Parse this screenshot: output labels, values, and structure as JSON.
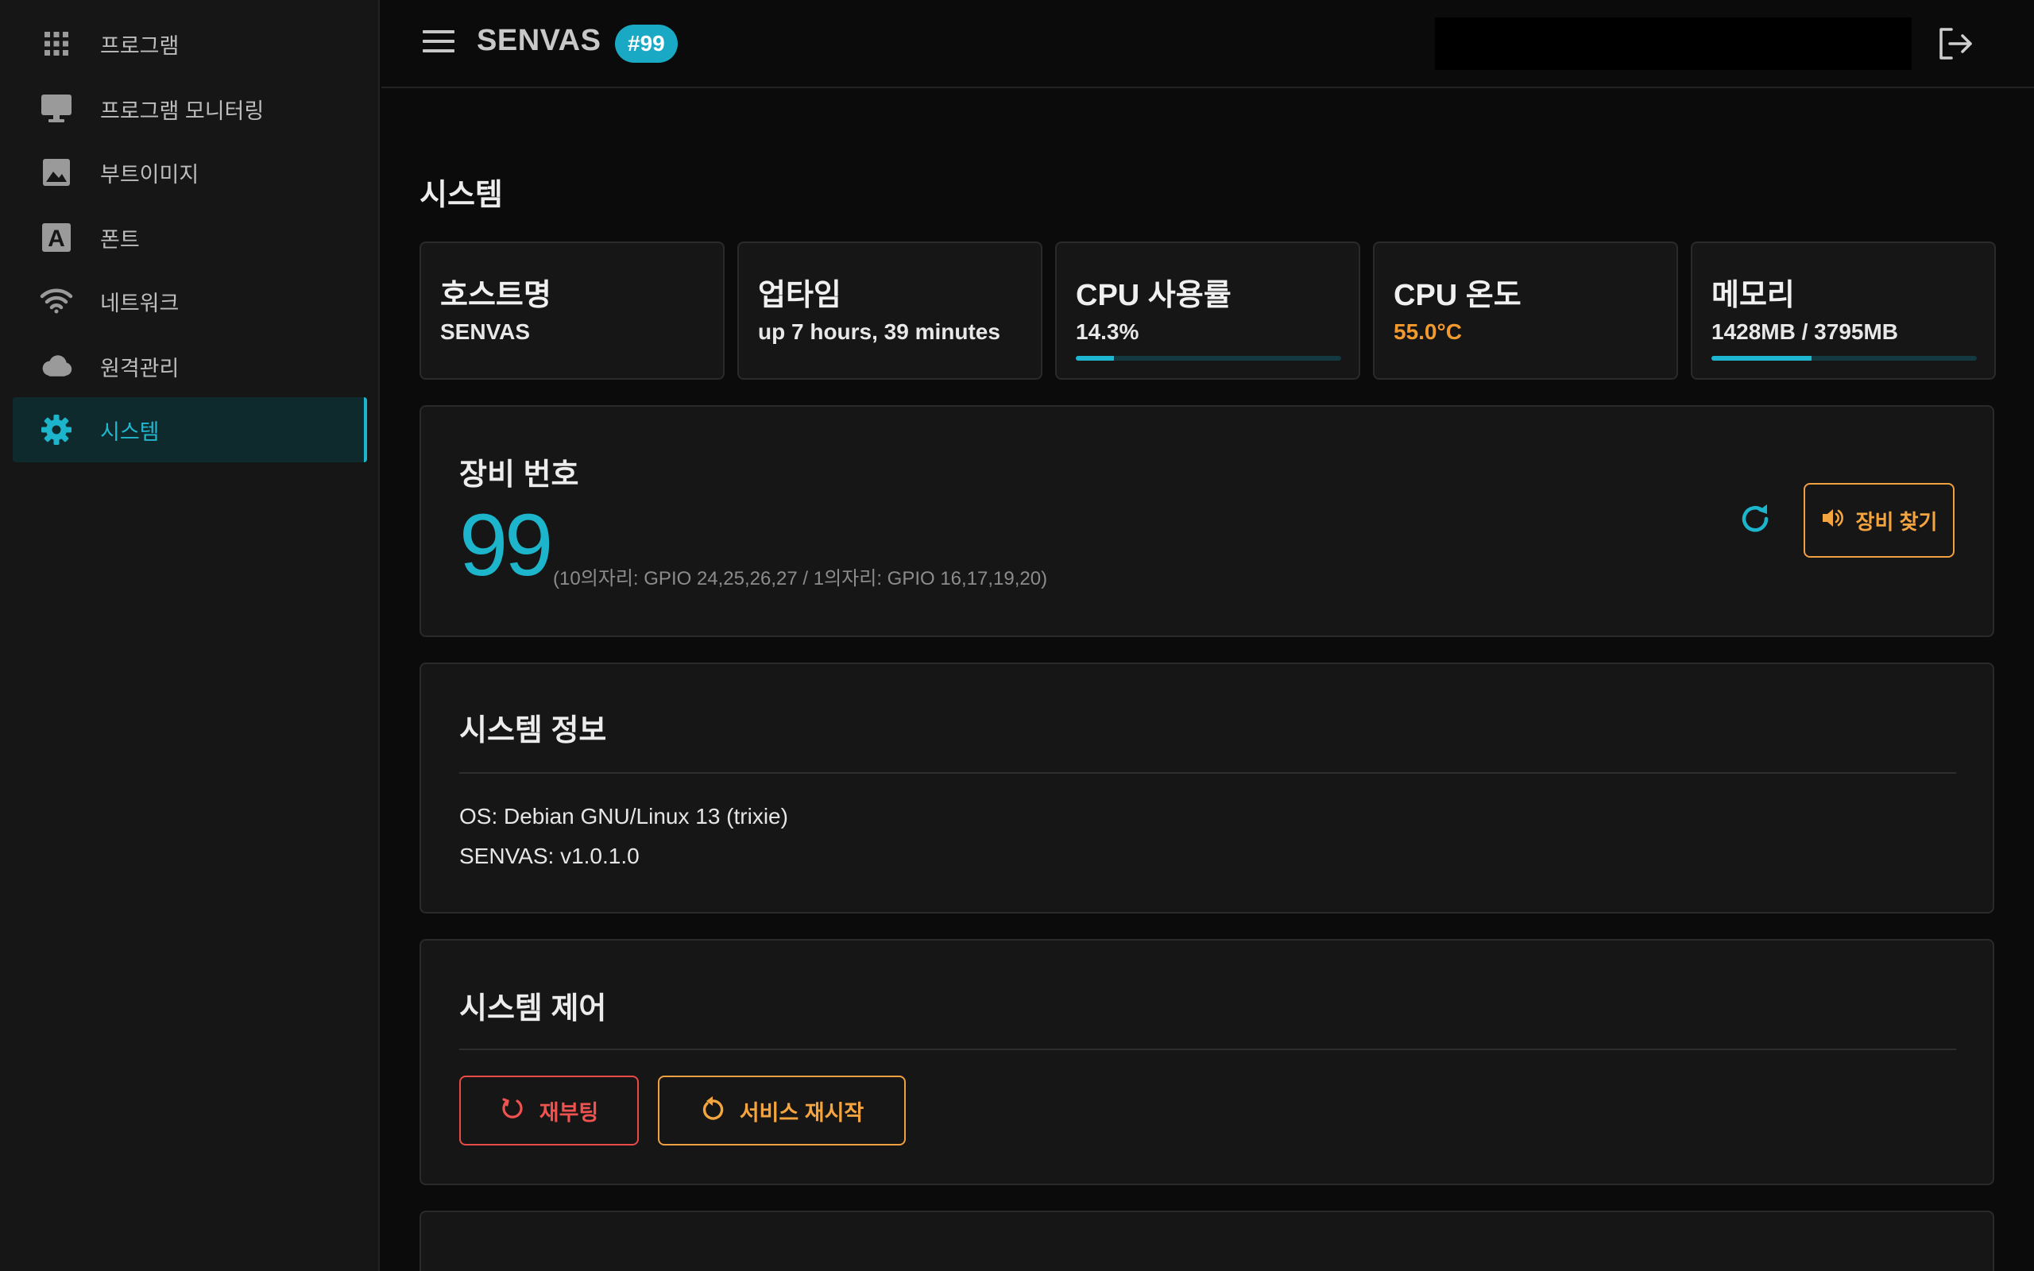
{
  "sidebar": {
    "items": [
      {
        "label": "프로그램",
        "icon": "apps-grid-icon"
      },
      {
        "label": "프로그램 모니터링",
        "icon": "monitor-icon"
      },
      {
        "label": "부트이미지",
        "icon": "image-icon"
      },
      {
        "label": "폰트",
        "icon": "font-icon"
      },
      {
        "label": "네트워크",
        "icon": "wifi-icon"
      },
      {
        "label": "원격관리",
        "icon": "cloud-icon"
      },
      {
        "label": "시스템",
        "icon": "gear-icon",
        "active": true
      }
    ]
  },
  "header": {
    "title": "SENVAS",
    "badge": "#99"
  },
  "main": {
    "section_title": "시스템",
    "stats": [
      {
        "title": "호스트명",
        "value": "SENVAS"
      },
      {
        "title": "업타임",
        "value": "up 7 hours, 39 minutes"
      },
      {
        "title": "CPU 사용률",
        "value": "14.3%",
        "progress": 0.143
      },
      {
        "title": "CPU 온도",
        "value": "55.0°C"
      },
      {
        "title": "메모리",
        "value": "1428MB / 3795MB",
        "progress": 0.376
      }
    ],
    "device": {
      "title": "장비 번호",
      "number": "99",
      "gpio": "(10의자리: GPIO 24,25,26,27 / 1의자리: GPIO 16,17,19,20)",
      "find_label": "장비 찾기"
    },
    "sysinfo": {
      "title": "시스템 정보",
      "os": "OS: Debian GNU/Linux 13 (trixie)",
      "version": "SENVAS: v1.0.1.0"
    },
    "control": {
      "title": "시스템 제어",
      "reboot_label": "재부팅",
      "restart_label": "서비스 재시작"
    }
  },
  "colors": {
    "accent": "#1cb5cc",
    "warning": "#f5a53f",
    "danger": "#f0534f",
    "background": "#0b0b0b",
    "card": "#161616"
  }
}
